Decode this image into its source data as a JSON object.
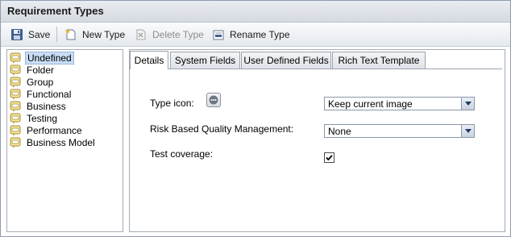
{
  "window": {
    "title": "Requirement Types"
  },
  "toolbar": {
    "save_label": "Save",
    "new_type_label": "New Type",
    "delete_type_label": "Delete Type",
    "rename_type_label": "Rename Type"
  },
  "tree": {
    "items": [
      {
        "label": "Undefined",
        "selected": true
      },
      {
        "label": "Folder"
      },
      {
        "label": "Group"
      },
      {
        "label": "Functional"
      },
      {
        "label": "Business"
      },
      {
        "label": "Testing"
      },
      {
        "label": "Performance"
      },
      {
        "label": "Business Model"
      }
    ]
  },
  "tabs": [
    {
      "label": "Details",
      "active": true
    },
    {
      "label": "System Fields"
    },
    {
      "label": "User Defined Fields"
    },
    {
      "label": "Rich Text Template"
    }
  ],
  "details": {
    "type_icon_label": "Type icon:",
    "type_icon_value": "Keep current image",
    "rbqm_label": "Risk Based Quality Management:",
    "rbqm_value": "None",
    "test_coverage_label": "Test coverage:",
    "test_coverage_checked": true
  }
}
